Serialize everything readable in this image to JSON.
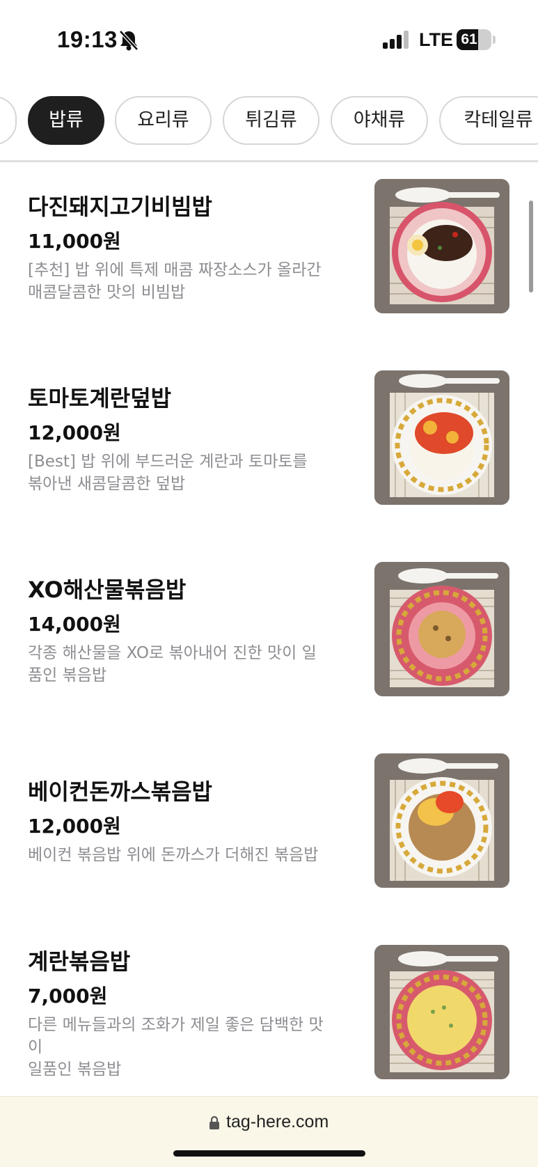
{
  "status_bar": {
    "time": "19:13",
    "network": "LTE",
    "battery": "61",
    "battery_fraction": 0.61,
    "icons": [
      "bell-slash-icon",
      "cellular-signal-icon",
      "battery-icon"
    ]
  },
  "tabs": [
    {
      "label": "밥류",
      "active": true
    },
    {
      "label": "요리류",
      "active": false
    },
    {
      "label": "튀김류",
      "active": false
    },
    {
      "label": "야채류",
      "active": false
    },
    {
      "label": "칵테일류",
      "active": false
    }
  ],
  "menu": [
    {
      "name": "다진돼지고기비빔밥",
      "price": "11,000원",
      "description": "[추천] 밥 위에 특제 매콤 짜장소스가 올라간\n매콤달콤한 맛의 비빔밥",
      "image": "dish-photo-icon"
    },
    {
      "name": "토마토계란덮밥",
      "price": "12,000원",
      "description": "[Best] 밥 위에 부드러운 계란과 토마토를\n볶아낸 새콤달콤한 덮밥",
      "image": "dish-photo-icon"
    },
    {
      "name": "XO해산물볶음밥",
      "price": "14,000원",
      "description": "각종 해산물을 XO로 볶아내어 진한 맛이 일\n품인 볶음밥",
      "image": "dish-photo-icon"
    },
    {
      "name": "베이컨돈까스볶음밥",
      "price": "12,000원",
      "description": "베이컨 볶음밥 위에 돈까스가 더해진 볶음밥",
      "image": "dish-photo-icon"
    },
    {
      "name": "계란볶음밥",
      "price": "7,000원",
      "description": "다른 메뉴들과의 조화가 제일 좋은 담백한 맛\n이\n일품인 볶음밥",
      "image": "dish-photo-icon"
    }
  ],
  "browser": {
    "url": "tag-here.com"
  },
  "colors": {
    "active_tab_bg": "#1f1f1f",
    "description_text": "#8d8d92",
    "url_bar_bg": "#faf6e8"
  }
}
